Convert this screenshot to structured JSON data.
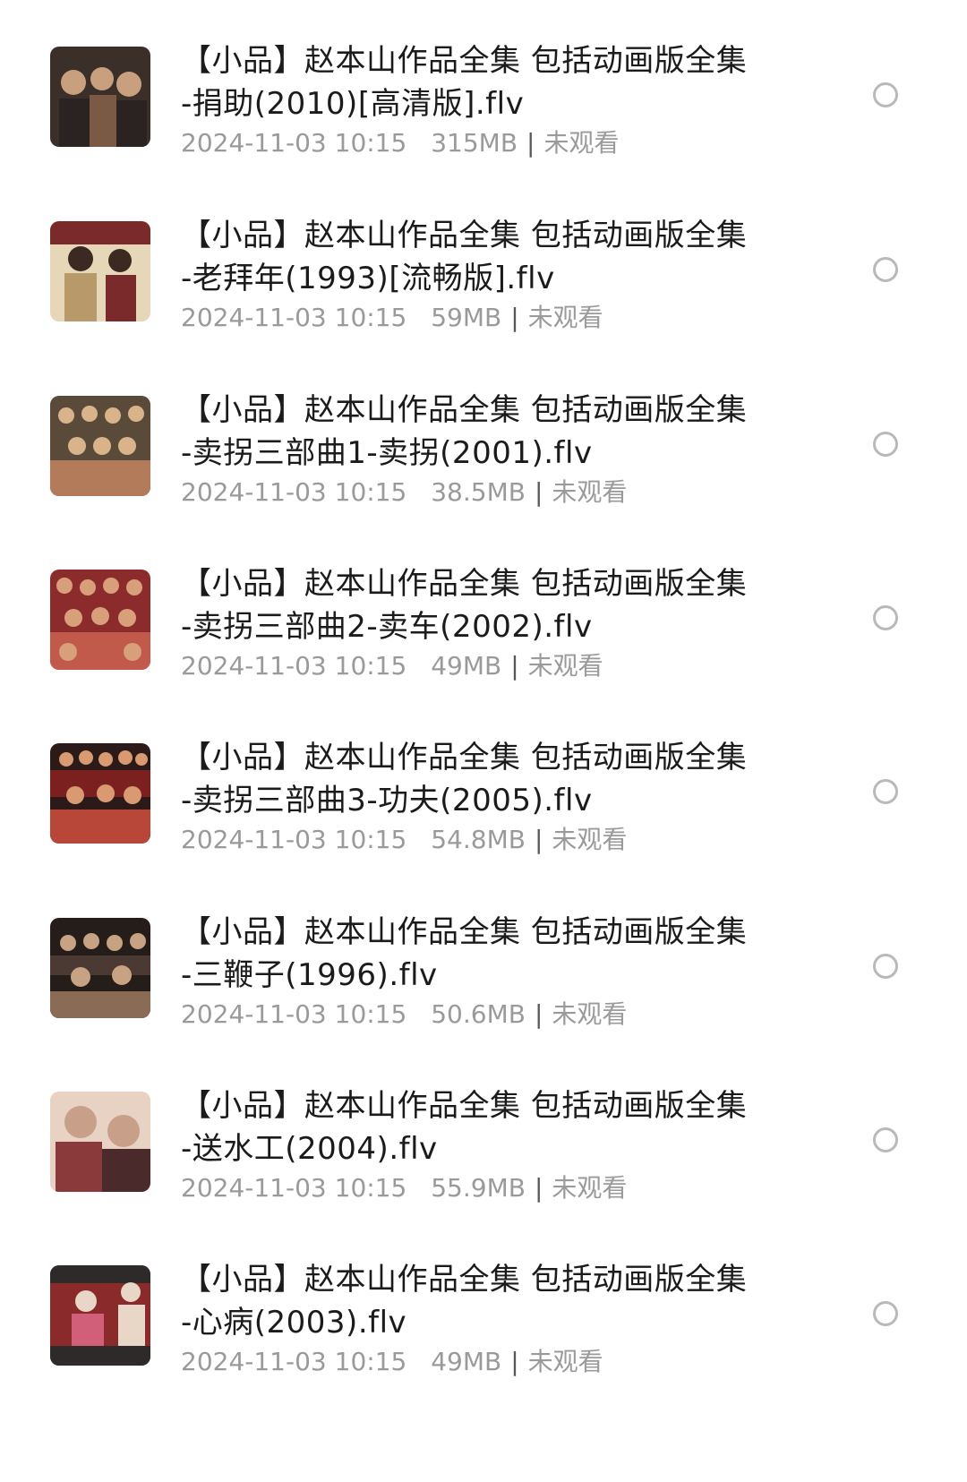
{
  "files": [
    {
      "title_line1": "【小品】赵本山作品全集 包括动画版全集",
      "title_line2": "-捐助(2010)[高清版].flv",
      "date": "2024-11-03 10:15",
      "size": "315MB",
      "status": "未观看",
      "thumb_palette": [
        "#3b2f2a",
        "#7a5a45",
        "#c9a07e",
        "#2a2322"
      ]
    },
    {
      "title_line1": "【小品】赵本山作品全集 包括动画版全集",
      "title_line2": "-老拜年(1993)[流畅版].flv",
      "date": "2024-11-03 10:15",
      "size": "59MB",
      "status": "未观看",
      "thumb_palette": [
        "#7a2a2a",
        "#b89a6a",
        "#e6d7b8",
        "#3c2a22"
      ]
    },
    {
      "title_line1": "【小品】赵本山作品全集 包括动画版全集",
      "title_line2": "-卖拐三部曲1-卖拐(2001).flv",
      "date": "2024-11-03 10:15",
      "size": "38.5MB",
      "status": "未观看",
      "thumb_palette": [
        "#5a4a3a",
        "#b37b5a",
        "#d9b48a",
        "#2d2420"
      ]
    },
    {
      "title_line1": "【小品】赵本山作品全集 包括动画版全集",
      "title_line2": "-卖拐三部曲2-卖车(2002).flv",
      "date": "2024-11-03 10:15",
      "size": "49MB",
      "status": "未观看",
      "thumb_palette": [
        "#8b2b2b",
        "#c15a4a",
        "#d8a07a",
        "#3a2020"
      ]
    },
    {
      "title_line1": "【小品】赵本山作品全集 包括动画版全集",
      "title_line2": "-卖拐三部曲3-功夫(2005).flv",
      "date": "2024-11-03 10:15",
      "size": "54.8MB",
      "status": "未观看",
      "thumb_palette": [
        "#7b1f1f",
        "#b8473a",
        "#d99a72",
        "#2b1a18"
      ]
    },
    {
      "title_line1": "【小品】赵本山作品全集 包括动画版全集",
      "title_line2": "-三鞭子(1996).flv",
      "date": "2024-11-03 10:15",
      "size": "50.6MB",
      "status": "未观看",
      "thumb_palette": [
        "#4a3a33",
        "#8a6b55",
        "#c7a383",
        "#241d1a"
      ]
    },
    {
      "title_line1": "【小品】赵本山作品全集 包括动画版全集",
      "title_line2": "-送水工(2004).flv",
      "date": "2024-11-03 10:15",
      "size": "55.9MB",
      "status": "未观看",
      "thumb_palette": [
        "#8a3a3a",
        "#c8a08a",
        "#e7d2c3",
        "#4a2a2a"
      ]
    },
    {
      "title_line1": "【小品】赵本山作品全集 包括动画版全集",
      "title_line2": "-心病(2003).flv",
      "date": "2024-11-03 10:15",
      "size": "49MB",
      "status": "未观看",
      "thumb_palette": [
        "#8a2a2a",
        "#d15f7a",
        "#e8d7c7",
        "#2f2a2a"
      ]
    }
  ]
}
